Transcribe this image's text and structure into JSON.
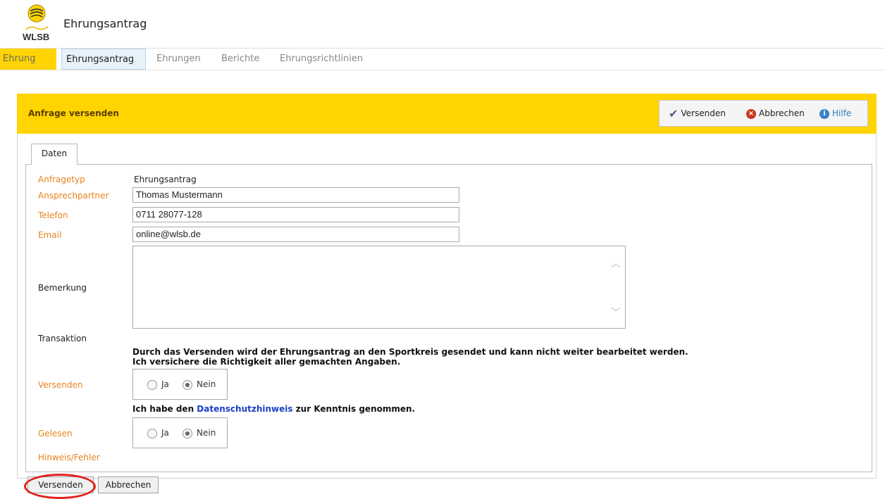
{
  "header": {
    "logo_text": "WLSB",
    "app_title": "Ehrungsantrag"
  },
  "nav": {
    "items": [
      "Ehrung",
      "Ehrungsantrag",
      "Ehrungen",
      "Berichte",
      "Ehrungsrichtlinien"
    ]
  },
  "panel": {
    "title": "Anfrage versenden",
    "toolbar": {
      "send_label": "Versenden",
      "cancel_label": "Abbrechen",
      "help_label": "Hilfe"
    },
    "tab_label": "Daten"
  },
  "form": {
    "anfragetyp_label": "Anfragetyp",
    "anfragetyp_value": "Ehrungsantrag",
    "ansprechpartner_label": "Ansprechpartner",
    "ansprechpartner_value": "Thomas Mustermann",
    "telefon_label": "Telefon",
    "telefon_value": "0711 28077-128",
    "email_label": "Email",
    "email_value": "online@wlsb.de",
    "bemerkung_label": "Bemerkung",
    "bemerkung_value": "",
    "transaktion_label": "Transaktion",
    "notice_line1": "Durch das Versenden wird der Ehrungsantrag an den Sportkreis gesendet und kann nicht weiter bearbeitet werden.",
    "notice_line2": "Ich versichere die Richtigkeit aller gemachten Angaben.",
    "versenden_label": "Versenden",
    "radio_ja": "Ja",
    "radio_nein": "Nein",
    "versenden_selected": "Nein",
    "privacy_prefix": "Ich habe den ",
    "privacy_link": "Datenschutzhinweis",
    "privacy_suffix": " zur Kenntnis genommen.",
    "gelesen_label": "Gelesen",
    "gelesen_selected": "Nein",
    "hinweis_label": "Hinweis/Fehler"
  },
  "buttons": {
    "send_label": "Versenden",
    "cancel_label": "Abbrechen"
  },
  "colors": {
    "accent_yellow": "#ffd400",
    "label_orange": "#e8831e",
    "link_blue": "#1a3fc4",
    "highlight_red": "#e0201b"
  }
}
